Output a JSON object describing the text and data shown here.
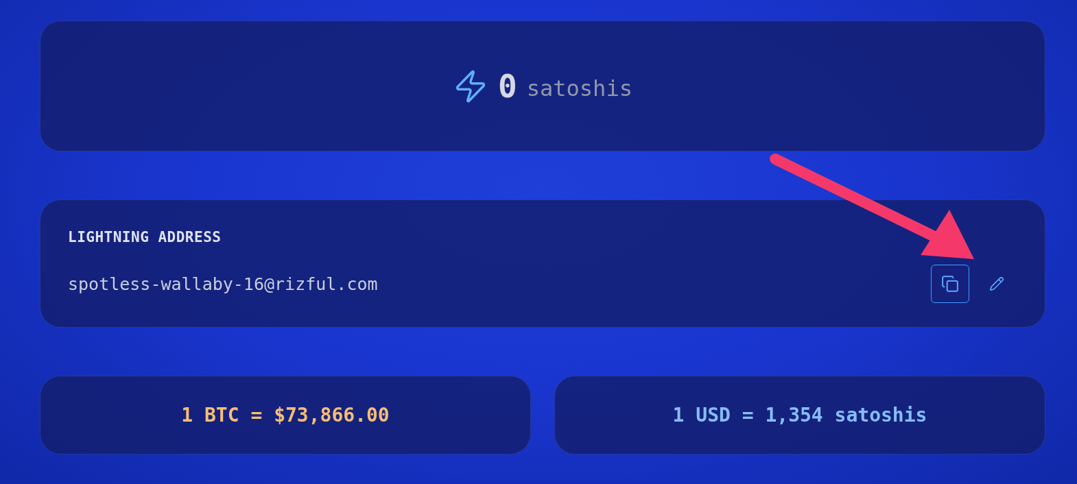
{
  "balance": {
    "amount": "0",
    "unit": "satoshis"
  },
  "lightning_address": {
    "label": "LIGHTNING ADDRESS",
    "value": "spotless-wallaby-16@rizful.com",
    "actions": [
      {
        "kind": "copy",
        "selected": true
      },
      {
        "kind": "edit",
        "selected": false
      }
    ]
  },
  "rates": [
    {
      "text": "1 BTC = $73,866.00",
      "color": "#f8bd73"
    },
    {
      "text": "1 USD = 1,354 satoshis",
      "color": "#86bdf8"
    }
  ]
}
